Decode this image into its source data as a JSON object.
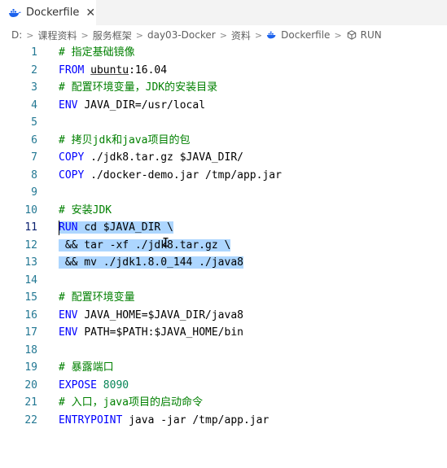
{
  "tab": {
    "title": "Dockerfile",
    "close_label": "✕"
  },
  "breadcrumb": {
    "items": [
      "D:",
      "课程资料",
      "服务框架",
      "day03-Docker",
      "资料",
      "Dockerfile",
      "RUN"
    ],
    "separator": ">"
  },
  "colors": {
    "keyword": "#0000ff",
    "comment": "#008000",
    "number": "#098658",
    "line_number": "#237893",
    "selection": "#add6ff",
    "docker_blue": "#1d63ed"
  },
  "editor": {
    "lines": [
      {
        "n": "1",
        "segs": [
          {
            "t": "# 指定基础镜像",
            "c": "cm"
          }
        ]
      },
      {
        "n": "2",
        "segs": [
          {
            "t": "FROM ",
            "c": "kw"
          },
          {
            "t": "ubuntu",
            "c": "u"
          },
          {
            "t": ":16.04",
            "c": ""
          }
        ]
      },
      {
        "n": "3",
        "segs": [
          {
            "t": "# 配置环境变量，JDK的安装目录",
            "c": "cm"
          }
        ]
      },
      {
        "n": "4",
        "segs": [
          {
            "t": "ENV ",
            "c": "kw"
          },
          {
            "t": "JAVA_DIR=/usr/local",
            "c": ""
          }
        ]
      },
      {
        "n": "5",
        "segs": []
      },
      {
        "n": "6",
        "segs": [
          {
            "t": "# 拷贝jdk和java项目的包",
            "c": "cm"
          }
        ]
      },
      {
        "n": "7",
        "segs": [
          {
            "t": "COPY ",
            "c": "kw"
          },
          {
            "t": "./jdk8.tar.gz $JAVA_DIR/",
            "c": ""
          }
        ]
      },
      {
        "n": "8",
        "segs": [
          {
            "t": "COPY ",
            "c": "kw"
          },
          {
            "t": "./docker-demo.jar /tmp/app.jar",
            "c": ""
          }
        ]
      },
      {
        "n": "9",
        "segs": []
      },
      {
        "n": "10",
        "segs": [
          {
            "t": "# 安装JDK",
            "c": "cm"
          }
        ]
      },
      {
        "n": "11",
        "segs": [
          {
            "t": "RUN ",
            "c": "kw sel"
          },
          {
            "t": "cd $JAVA_DIR \\",
            "c": "sel"
          }
        ],
        "active": true
      },
      {
        "n": "12",
        "segs": [
          {
            "t": " && tar -xf ./jdk8.tar.gz \\",
            "c": "sel"
          }
        ]
      },
      {
        "n": "13",
        "segs": [
          {
            "t": " && mv ./jdk1.8.0_144 ./java8",
            "c": "sel"
          }
        ]
      },
      {
        "n": "14",
        "segs": []
      },
      {
        "n": "15",
        "segs": [
          {
            "t": "# 配置环境变量",
            "c": "cm"
          }
        ]
      },
      {
        "n": "16",
        "segs": [
          {
            "t": "ENV ",
            "c": "kw"
          },
          {
            "t": "JAVA_HOME=$JAVA_DIR/java8",
            "c": ""
          }
        ]
      },
      {
        "n": "17",
        "segs": [
          {
            "t": "ENV ",
            "c": "kw"
          },
          {
            "t": "PATH=$PATH:$JAVA_HOME/bin",
            "c": ""
          }
        ]
      },
      {
        "n": "18",
        "segs": []
      },
      {
        "n": "19",
        "segs": [
          {
            "t": "# 暴露端口",
            "c": "cm"
          }
        ]
      },
      {
        "n": "20",
        "segs": [
          {
            "t": "EXPOSE ",
            "c": "kw"
          },
          {
            "t": "8090",
            "c": "num"
          }
        ]
      },
      {
        "n": "21",
        "segs": [
          {
            "t": "# 入口，java项目的启动命令",
            "c": "cm"
          }
        ]
      },
      {
        "n": "22",
        "segs": [
          {
            "t": "ENTRYPOINT ",
            "c": "kw"
          },
          {
            "t": "java -jar /tmp/app.jar",
            "c": ""
          }
        ]
      }
    ]
  }
}
